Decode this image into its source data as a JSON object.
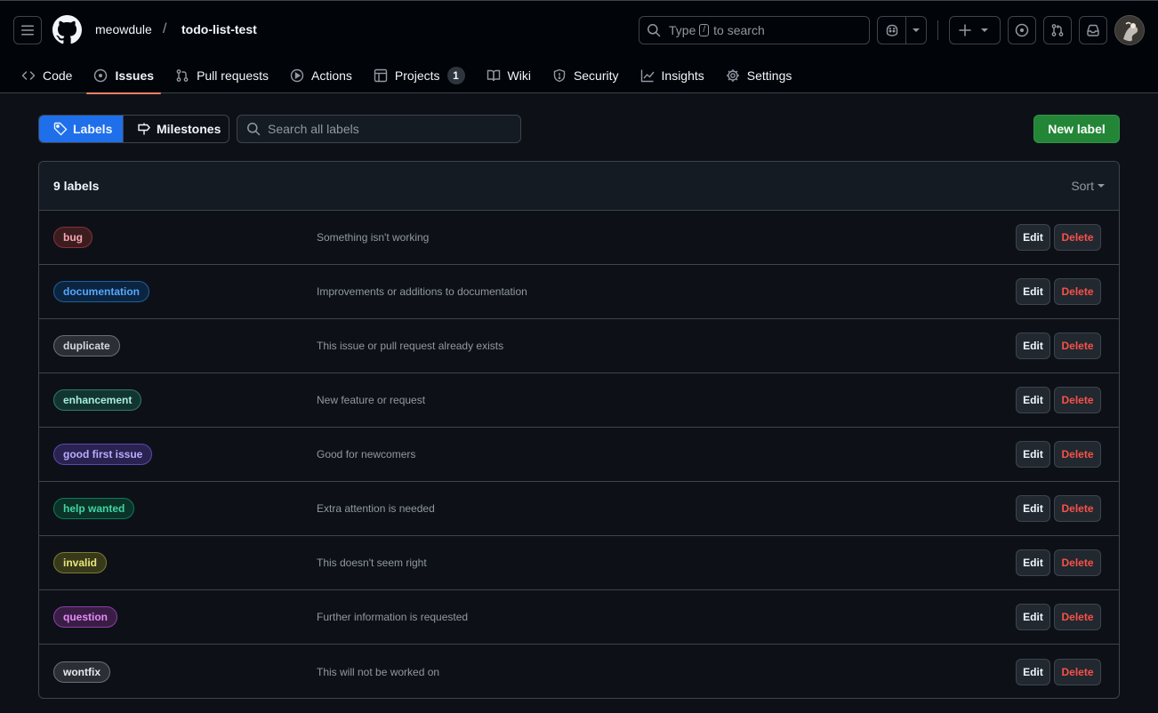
{
  "header": {
    "owner": "meowdule",
    "separator": "/",
    "repo": "todo-list-test",
    "search_prefix": "Type",
    "search_key": "/",
    "search_suffix": "to search"
  },
  "tabs": [
    {
      "label": "Code",
      "icon": "code-icon"
    },
    {
      "label": "Issues",
      "icon": "issue-opened-icon",
      "selected": true
    },
    {
      "label": "Pull requests",
      "icon": "git-pull-request-icon"
    },
    {
      "label": "Actions",
      "icon": "play-icon"
    },
    {
      "label": "Projects",
      "icon": "table-icon",
      "counter": "1"
    },
    {
      "label": "Wiki",
      "icon": "book-icon"
    },
    {
      "label": "Security",
      "icon": "shield-icon"
    },
    {
      "label": "Insights",
      "icon": "graph-icon"
    },
    {
      "label": "Settings",
      "icon": "gear-icon"
    }
  ],
  "subnav": {
    "labels": "Labels",
    "milestones": "Milestones",
    "search_placeholder": "Search all labels",
    "new_label": "New label"
  },
  "box": {
    "count": "9 labels",
    "sort": "Sort"
  },
  "labels": [
    {
      "name": "bug",
      "description": "Something isn't working",
      "bg": "#3b1d20",
      "border": "#8b2e38",
      "fg": "#f8a6b0"
    },
    {
      "name": "documentation",
      "description": "Improvements or additions to documentation",
      "bg": "#0b2540",
      "border": "#1f5fa0",
      "fg": "#58a6ff"
    },
    {
      "name": "duplicate",
      "description": "This issue or pull request already exists",
      "bg": "#2b2f35",
      "border": "#6b7078",
      "fg": "#d5d8dc"
    },
    {
      "name": "enhancement",
      "description": "New feature or request",
      "bg": "#12352f",
      "border": "#2f7a6c",
      "fg": "#a5eede"
    },
    {
      "name": "good first issue",
      "description": "Good for newcomers",
      "bg": "#2a2250",
      "border": "#5a48b0",
      "fg": "#b8adff"
    },
    {
      "name": "help wanted",
      "description": "Extra attention is needed",
      "bg": "#0b3327",
      "border": "#0f7a5c",
      "fg": "#3fd6a6"
    },
    {
      "name": "invalid",
      "description": "This doesn't seem right",
      "bg": "#38391a",
      "border": "#7c7d2e",
      "fg": "#e6e77a"
    },
    {
      "name": "question",
      "description": "Further information is requested",
      "bg": "#3a1d45",
      "border": "#8a3fa6",
      "fg": "#e48cf5"
    },
    {
      "name": "wontfix",
      "description": "This will not be worked on",
      "bg": "#2b2f35",
      "border": "#6b7078",
      "fg": "#e8eaed"
    }
  ],
  "row_actions": {
    "edit": "Edit",
    "delete": "Delete"
  }
}
